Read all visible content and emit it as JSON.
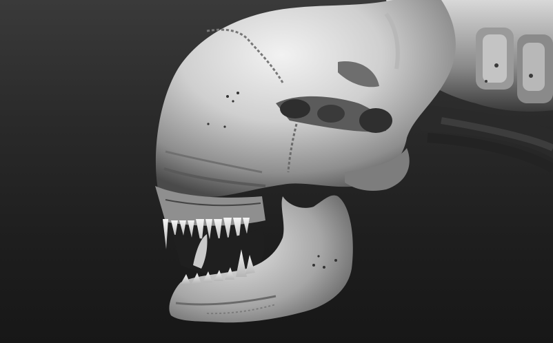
{
  "scene": {
    "subject": "sculpted-creature-skull",
    "style": "grayscale-clay-render",
    "colors": {
      "background_top": "#3a3a3a",
      "background_bottom": "#171717",
      "material_light": "#e9e9e9",
      "material_mid": "#a9a9a9",
      "material_dark": "#3b3b3b",
      "shadow": "#111111"
    }
  }
}
